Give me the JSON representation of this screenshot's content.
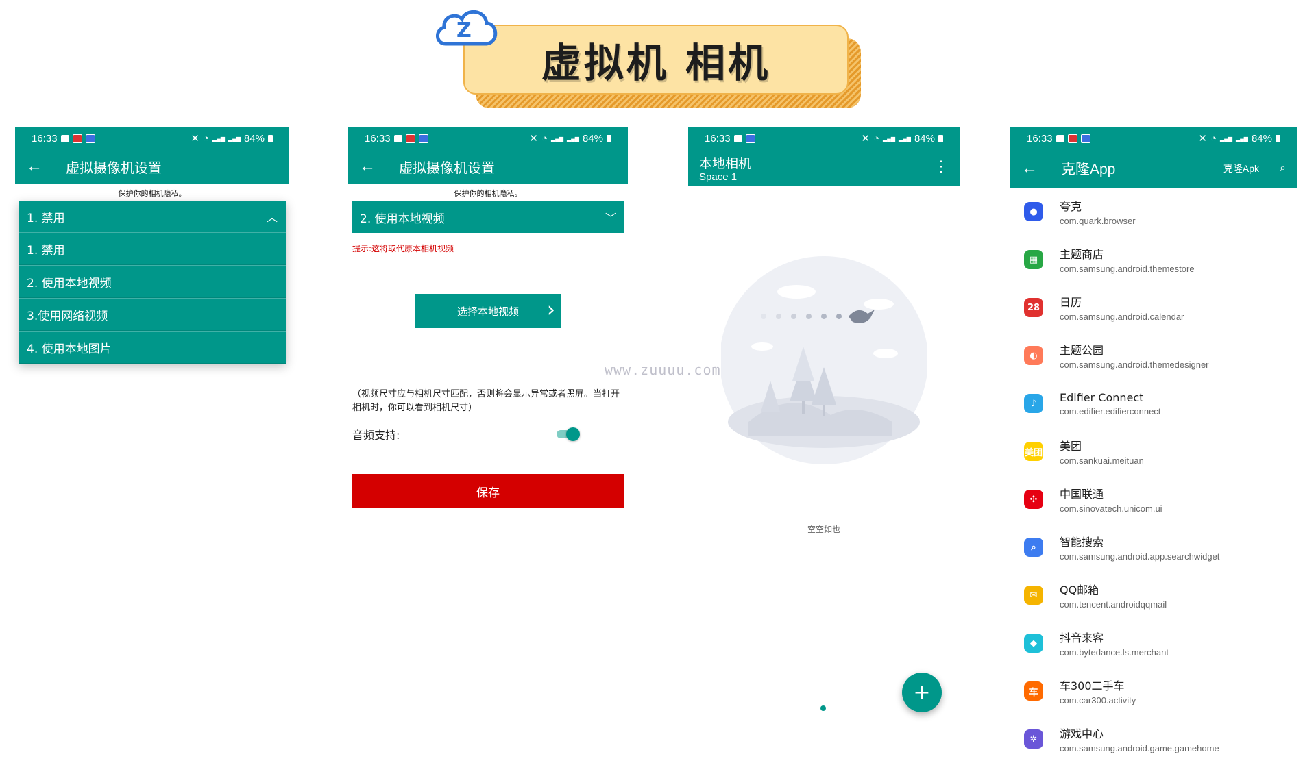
{
  "banner": {
    "title": "虚拟机 相机",
    "logo_letter": "Z"
  },
  "status": {
    "time": "16:33",
    "battery": "84%"
  },
  "screen1": {
    "toolbar_title": "虚拟摄像机设置",
    "privacy_hint": "保护你的相机隐私。",
    "selected": "1. 禁用",
    "options": [
      "1. 禁用",
      "2. 使用本地视频",
      "3.使用网络视频",
      "4. 使用本地图片"
    ]
  },
  "screen2": {
    "toolbar_title": "虚拟摄像机设置",
    "privacy_hint": "保护你的相机隐私。",
    "selected": "2. 使用本地视频",
    "warning": "提示:这将取代原本相机视频",
    "select_button": "选择本地视频",
    "size_note": "（视频尺寸应与相机尺寸匹配，否则将会显示异常或者黑屏。当打开相机时，你可以看到相机尺寸）",
    "audio_label": "音频支持:",
    "audio_enabled": true,
    "save_button": "保存"
  },
  "screen3": {
    "title": "本地相机",
    "subtitle": "Space 1",
    "empty_text": "空空如也",
    "fab": "+"
  },
  "watermark": "www.zuuuu.com",
  "screen4": {
    "toolbar_title": "克隆App",
    "apk_button": "克隆Apk",
    "apps": [
      {
        "name": "夸克",
        "pkg": "com.quark.browser",
        "color": "#2f5bea",
        "icon": "quark-icon",
        "glyph": "●"
      },
      {
        "name": "主题商店",
        "pkg": "com.samsung.android.themestore",
        "color": "#28a745",
        "icon": "themestore-icon",
        "glyph": "▦"
      },
      {
        "name": "日历",
        "pkg": "com.samsung.android.calendar",
        "color": "#e0312f",
        "icon": "calendar-icon",
        "glyph": "28"
      },
      {
        "name": "主题公园",
        "pkg": "com.samsung.android.themedesigner",
        "color": "#ff7a59",
        "icon": "themepark-icon",
        "glyph": "◐"
      },
      {
        "name": "Edifier Connect",
        "pkg": "com.edifier.edifierconnect",
        "color": "#29a6e8",
        "icon": "edifier-icon",
        "glyph": "♪"
      },
      {
        "name": "美团",
        "pkg": "com.sankuai.meituan",
        "color": "#ffd000",
        "icon": "meituan-icon",
        "glyph": "美团"
      },
      {
        "name": "中国联通",
        "pkg": "com.sinovatech.unicom.ui",
        "color": "#e60012",
        "icon": "unicom-icon",
        "glyph": "✣"
      },
      {
        "name": "智能搜索",
        "pkg": "com.samsung.android.app.searchwidget",
        "color": "#3d7cf0",
        "icon": "search-widget-icon",
        "glyph": "⌕"
      },
      {
        "name": "QQ邮箱",
        "pkg": "com.tencent.androidqqmail",
        "color": "#f5b400",
        "icon": "qqmail-icon",
        "glyph": "✉"
      },
      {
        "name": "抖音来客",
        "pkg": "com.bytedance.ls.merchant",
        "color": "#1ec0d8",
        "icon": "douyin-merchant-icon",
        "glyph": "◆"
      },
      {
        "name": "车300二手车",
        "pkg": "com.car300.activity",
        "color": "#ff6a00",
        "icon": "car300-icon",
        "glyph": "车"
      },
      {
        "name": "游戏中心",
        "pkg": "com.samsung.android.game.gamehome",
        "color": "#6a56d8",
        "icon": "gamehome-icon",
        "glyph": "✲"
      }
    ]
  }
}
